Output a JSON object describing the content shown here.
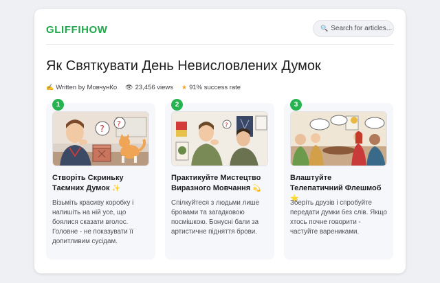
{
  "header": {
    "logo": "GLIFFIHOW",
    "search_placeholder": "Search for articles..."
  },
  "article": {
    "title": "Як Святкувати День Невисловлених Думок",
    "author": "Written by МовчунКо",
    "views": "23,456 views",
    "success": "91% success rate"
  },
  "steps": [
    {
      "number": "1",
      "title": "Створіть Скриньку Таємних Думок",
      "emoji": "✨",
      "text": "Візьміть красиву коробку і напишіть на ній усе, що боялися сказати вголос. Головне - не показувати її допитливим сусідам."
    },
    {
      "number": "2",
      "title": "Практикуйте Мистецтво Виразного Мовчання",
      "emoji": "💫",
      "text": "Спілкуйтеся з людьми лише бровами та загадковою посмішкою. Бонусні бали за артистичне підняття брови."
    },
    {
      "number": "3",
      "title": "Влаштуйте Телепатичний Флешмоб",
      "emoji": "⭐",
      "text": "Зберіть друзів і спробуйте передати думки без слів. Якщо хтось почне говорити - частуйте варениками."
    }
  ],
  "icons": {
    "search": "search-icon",
    "author": "pencil-icon",
    "views": "eye-icon",
    "success": "star-icon"
  },
  "colors": {
    "brand": "#1ea84a",
    "badge": "#27b34f",
    "star": "#f2a31c"
  }
}
